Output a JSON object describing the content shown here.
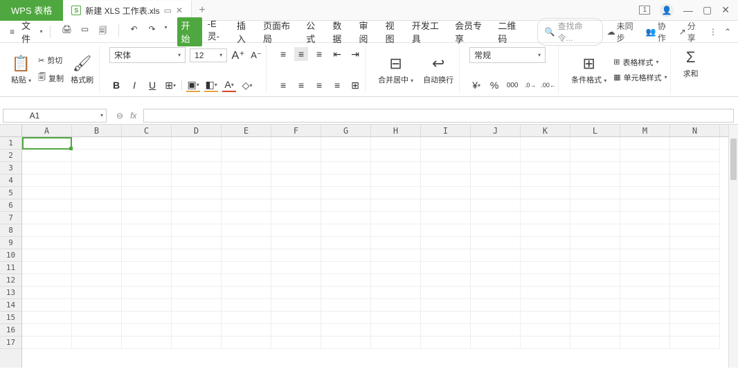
{
  "app": {
    "name": "WPS 表格"
  },
  "doc_tab": {
    "filename": "新建 XLS 工作表.xls"
  },
  "window": {
    "count": "1"
  },
  "file_menu": {
    "label": "文件"
  },
  "tabs": {
    "active": "开始",
    "items": [
      "开始",
      "-E灵-",
      "插入",
      "页面布局",
      "公式",
      "数据",
      "审阅",
      "视图",
      "开发工具",
      "会员专享",
      "二维码"
    ]
  },
  "search": {
    "placeholder": "查找命令..."
  },
  "topright": {
    "sync": "未同步",
    "coop": "协作",
    "share": "分享"
  },
  "clipboard": {
    "paste": "粘贴",
    "cut": "剪切",
    "copy": "复制",
    "brush": "格式刷"
  },
  "font": {
    "name": "宋体",
    "size": "12"
  },
  "align": {
    "merge": "合并居中",
    "wrap": "自动换行"
  },
  "number": {
    "format": "常规"
  },
  "styles": {
    "cond": "条件格式",
    "table": "表格样式",
    "cell": "单元格样式"
  },
  "calc": {
    "sum": "求和"
  },
  "name_box": {
    "value": "A1"
  },
  "columns": [
    "A",
    "B",
    "C",
    "D",
    "E",
    "F",
    "G",
    "H",
    "I",
    "J",
    "K",
    "L",
    "M",
    "N"
  ],
  "rows": [
    "1",
    "2",
    "3",
    "4",
    "5",
    "6",
    "7",
    "8",
    "9",
    "10",
    "11",
    "12",
    "13",
    "14",
    "15",
    "16",
    "17"
  ]
}
